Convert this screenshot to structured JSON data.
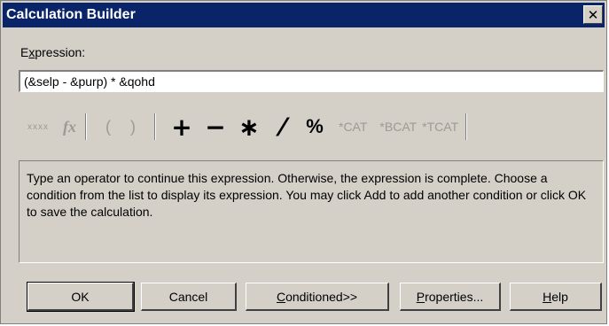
{
  "window": {
    "title": "Calculation Builder",
    "close_glyph": "✕"
  },
  "expression": {
    "label_first": "E",
    "label_mnemonic": "x",
    "label_rest": "pression:",
    "value": "(&selp - &purp) * &qohd"
  },
  "toolbar": {
    "field_glyph": "xxxx",
    "function_glyph": "fx",
    "open_paren": "(",
    "close_paren": ")",
    "plus": "+",
    "minus": "−",
    "multiply": "∗",
    "divide": "⁄",
    "percent": "%",
    "cat": "*CAT",
    "bcat": "*BCAT",
    "tcat": "*TCAT"
  },
  "message": {
    "text": "Type an operator to continue this expression.  Otherwise, the expression is complete. Choose a condition from the list to display its expression.  You may click Add to add another condition or click OK to save the calculation."
  },
  "buttons": {
    "ok": "OK",
    "cancel": "Cancel",
    "conditioned_mnemonic": "C",
    "conditioned_rest": "onditioned>>",
    "properties_mnemonic": "P",
    "properties_rest": "roperties...",
    "help_mnemonic": "H",
    "help_rest": "elp"
  },
  "colors": {
    "titlebar": "#0a246a",
    "face": "#d4d0c8",
    "disabled_text": "#9c9a94"
  }
}
